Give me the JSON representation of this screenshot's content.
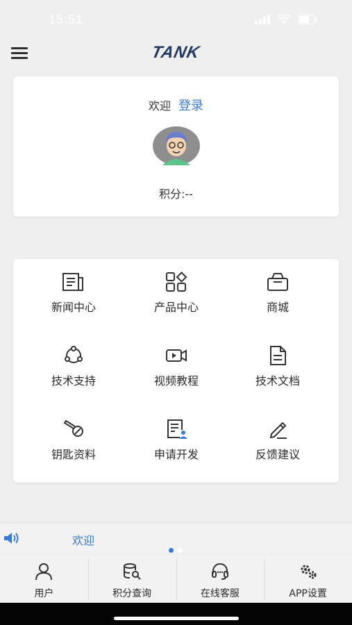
{
  "status_bar": {
    "time": "15:51"
  },
  "header": {
    "logo_text": "TANK"
  },
  "profile": {
    "welcome": "欢迎",
    "login_link": "登录",
    "points": "积分:--"
  },
  "menu": {
    "items": [
      {
        "label": "新闻中心",
        "icon": "newspaper-icon"
      },
      {
        "label": "产品中心",
        "icon": "products-grid-icon"
      },
      {
        "label": "商城",
        "icon": "shop-bag-icon"
      },
      {
        "label": "技术支持",
        "icon": "support-nodes-icon"
      },
      {
        "label": "视频教程",
        "icon": "video-camera-icon"
      },
      {
        "label": "技术文档",
        "icon": "document-icon"
      },
      {
        "label": "钥匙资料",
        "icon": "key-icon"
      },
      {
        "label": "申请开发",
        "icon": "apply-form-icon"
      },
      {
        "label": "反馈建议",
        "icon": "pencil-icon"
      }
    ]
  },
  "ticker": {
    "text": "欢迎"
  },
  "tabbar": {
    "tabs": [
      {
        "label": "用户",
        "icon": "user-icon"
      },
      {
        "label": "积分查询",
        "icon": "points-search-icon"
      },
      {
        "label": "在线客服",
        "icon": "headset-icon"
      },
      {
        "label": "APP设置",
        "icon": "settings-gears-icon"
      }
    ]
  },
  "colors": {
    "accent": "#3a7bd5",
    "logo": "#233a63",
    "background": "#efefef"
  }
}
